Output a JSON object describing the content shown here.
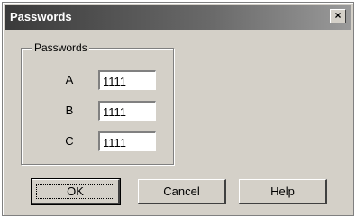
{
  "window": {
    "title": "Passwords",
    "close_glyph": "×"
  },
  "group": {
    "label": "Passwords"
  },
  "fields": [
    {
      "label": "A",
      "value": "1111"
    },
    {
      "label": "B",
      "value": "1111"
    },
    {
      "label": "C",
      "value": "1111"
    }
  ],
  "buttons": {
    "ok": "OK",
    "cancel": "Cancel",
    "help": "Help"
  }
}
